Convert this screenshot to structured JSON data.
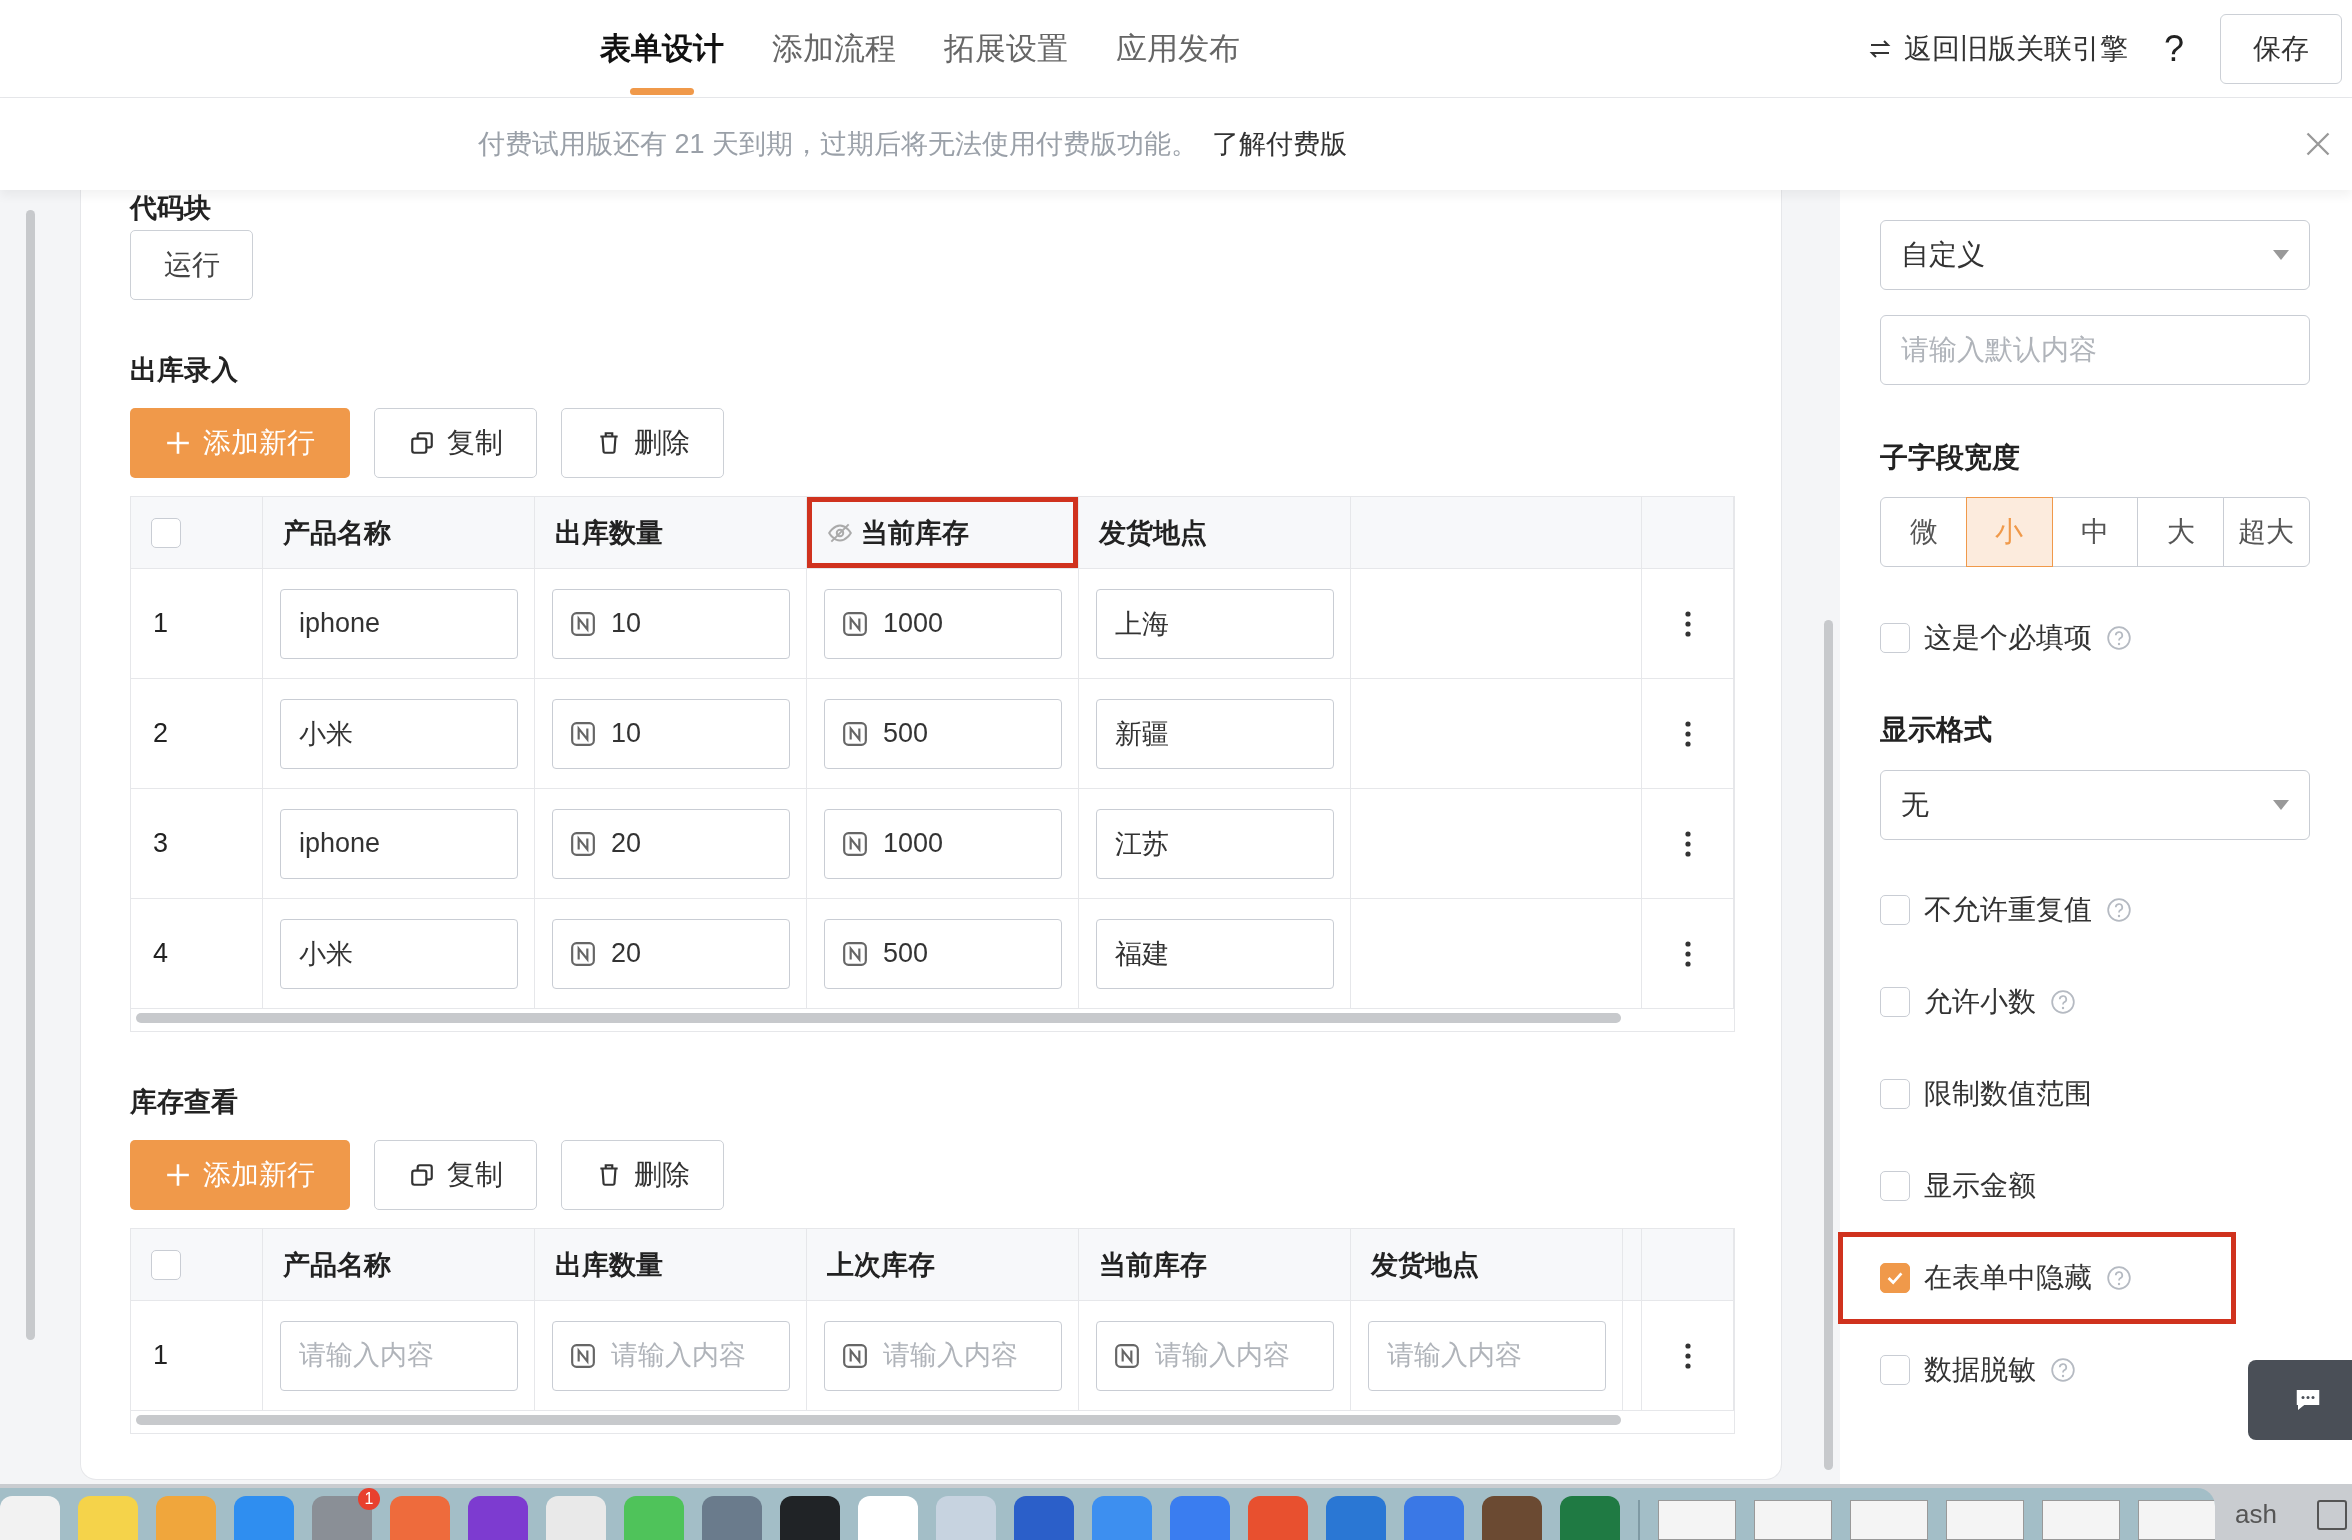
{
  "top_nav": {
    "tabs": [
      {
        "label": "表单设计",
        "selected": true
      },
      {
        "label": "添加流程",
        "selected": false
      },
      {
        "label": "拓展设置",
        "selected": false
      },
      {
        "label": "应用发布",
        "selected": false
      }
    ],
    "legacy_link": "返回旧版关联引擎",
    "help": "?",
    "save_button": "保存"
  },
  "banner": {
    "message": "付费试用版还有 21 天到期，过期后将无法使用付费版功能。",
    "link": "了解付费版"
  },
  "code_block": {
    "heading": "代码块",
    "run_button": "运行"
  },
  "tables": [
    {
      "title": "出库录入",
      "all_selected": false,
      "actions": [
        {
          "kind": "add",
          "label": "添加新行"
        },
        {
          "kind": "copy",
          "label": "复制"
        },
        {
          "kind": "delete",
          "label": "删除"
        }
      ],
      "columns": [
        {
          "label": "产品名称",
          "hidden": false,
          "highlighted": false
        },
        {
          "label": "出库数量",
          "hidden": false,
          "highlighted": false
        },
        {
          "label": "当前库存",
          "hidden": true,
          "highlighted": true
        },
        {
          "label": "发货地点",
          "hidden": false,
          "highlighted": false
        }
      ],
      "rows": [
        {
          "index": "1",
          "cells": [
            {
              "kind": "text",
              "value": "iphone"
            },
            {
              "kind": "number",
              "value": "10"
            },
            {
              "kind": "number",
              "value": "1000"
            },
            {
              "kind": "text",
              "value": "上海"
            }
          ]
        },
        {
          "index": "2",
          "cells": [
            {
              "kind": "text",
              "value": "小米"
            },
            {
              "kind": "number",
              "value": "10"
            },
            {
              "kind": "number",
              "value": "500"
            },
            {
              "kind": "text",
              "value": "新疆"
            }
          ]
        },
        {
          "index": "3",
          "cells": [
            {
              "kind": "text",
              "value": "iphone"
            },
            {
              "kind": "number",
              "value": "20"
            },
            {
              "kind": "number",
              "value": "1000"
            },
            {
              "kind": "text",
              "value": "江苏"
            }
          ]
        },
        {
          "index": "4",
          "cells": [
            {
              "kind": "text",
              "value": "小米"
            },
            {
              "kind": "number",
              "value": "20"
            },
            {
              "kind": "number",
              "value": "500"
            },
            {
              "kind": "text",
              "value": "福建"
            }
          ]
        }
      ]
    },
    {
      "title": "库存查看",
      "all_selected": false,
      "actions": [
        {
          "kind": "add",
          "label": "添加新行"
        },
        {
          "kind": "copy",
          "label": "复制"
        },
        {
          "kind": "delete",
          "label": "删除"
        }
      ],
      "columns": [
        {
          "label": "产品名称",
          "hidden": false,
          "highlighted": false
        },
        {
          "label": "出库数量",
          "hidden": false,
          "highlighted": false
        },
        {
          "label": "上次库存",
          "hidden": false,
          "highlighted": false
        },
        {
          "label": "当前库存",
          "hidden": false,
          "highlighted": false
        },
        {
          "label": "发货地点",
          "hidden": false,
          "highlighted": false
        }
      ],
      "rows": [
        {
          "index": "1",
          "cells": [
            {
              "kind": "text",
              "placeholder": "请输入内容"
            },
            {
              "kind": "number",
              "placeholder": "请输入内容"
            },
            {
              "kind": "number",
              "placeholder": "请输入内容"
            },
            {
              "kind": "number",
              "placeholder": "请输入内容"
            },
            {
              "kind": "text",
              "placeholder": "请输入内容"
            }
          ]
        }
      ]
    }
  ],
  "settings": {
    "default_select": "自定义",
    "default_input": {
      "placeholder": "请输入默认内容"
    },
    "width_heading": "子字段宽度",
    "width_options": [
      {
        "label": "微",
        "selected": false
      },
      {
        "label": "小",
        "selected": true
      },
      {
        "label": "中",
        "selected": false
      },
      {
        "label": "大",
        "selected": false
      },
      {
        "label": "超大",
        "selected": false
      }
    ],
    "required": {
      "label": "这是个必填项",
      "checked": false,
      "help": true,
      "highlighted": false
    },
    "format_heading": "显示格式",
    "format_select": "无",
    "options": [
      {
        "label": "不允许重复值",
        "checked": false,
        "help": true,
        "highlighted": false
      },
      {
        "label": "允许小数",
        "checked": false,
        "help": true,
        "highlighted": false
      },
      {
        "label": "限制数值范围",
        "checked": false,
        "help": false,
        "highlighted": false
      },
      {
        "label": "显示金额",
        "checked": false,
        "help": false,
        "highlighted": false
      },
      {
        "label": "在表单中隐藏",
        "checked": true,
        "help": true,
        "highlighted": true
      },
      {
        "label": "数据脱敏",
        "checked": false,
        "help": true,
        "highlighted": false
      }
    ]
  },
  "dock": {
    "badge": "1",
    "trash_label": "ash"
  }
}
